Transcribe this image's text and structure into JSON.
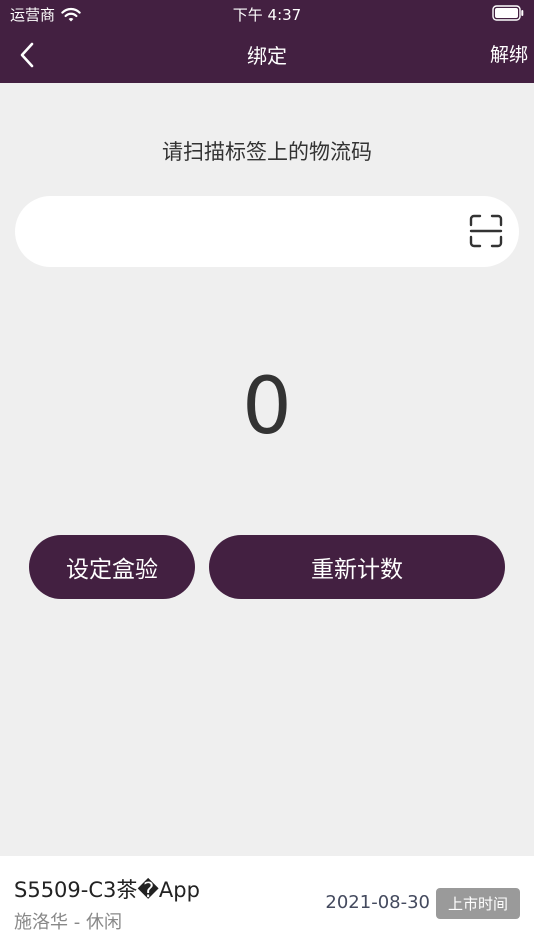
{
  "status_bar": {
    "carrier": "运营商",
    "time": "下午 4:37",
    "icons": [
      "wifi-icon",
      "battery-icon"
    ]
  },
  "nav": {
    "title": "绑定",
    "right_action": "解绑",
    "back_icon": "chevron-left-icon"
  },
  "main": {
    "prompt": "请扫描标签上的物流码",
    "scan_input": {
      "value": "",
      "placeholder": "",
      "icon": "scan-icon"
    },
    "count": "0",
    "buttons": {
      "set_box_check": "设定盒验",
      "recount": "重新计数"
    }
  },
  "product": {
    "name": "S5509-C3茶�App",
    "brand_category": "施洛华 - 休闲",
    "date": "2021-08-30",
    "date_tag": "上市时间"
  },
  "colors": {
    "primary": "#432041",
    "background": "#efefef",
    "tag_gray": "#9a9a9a"
  }
}
